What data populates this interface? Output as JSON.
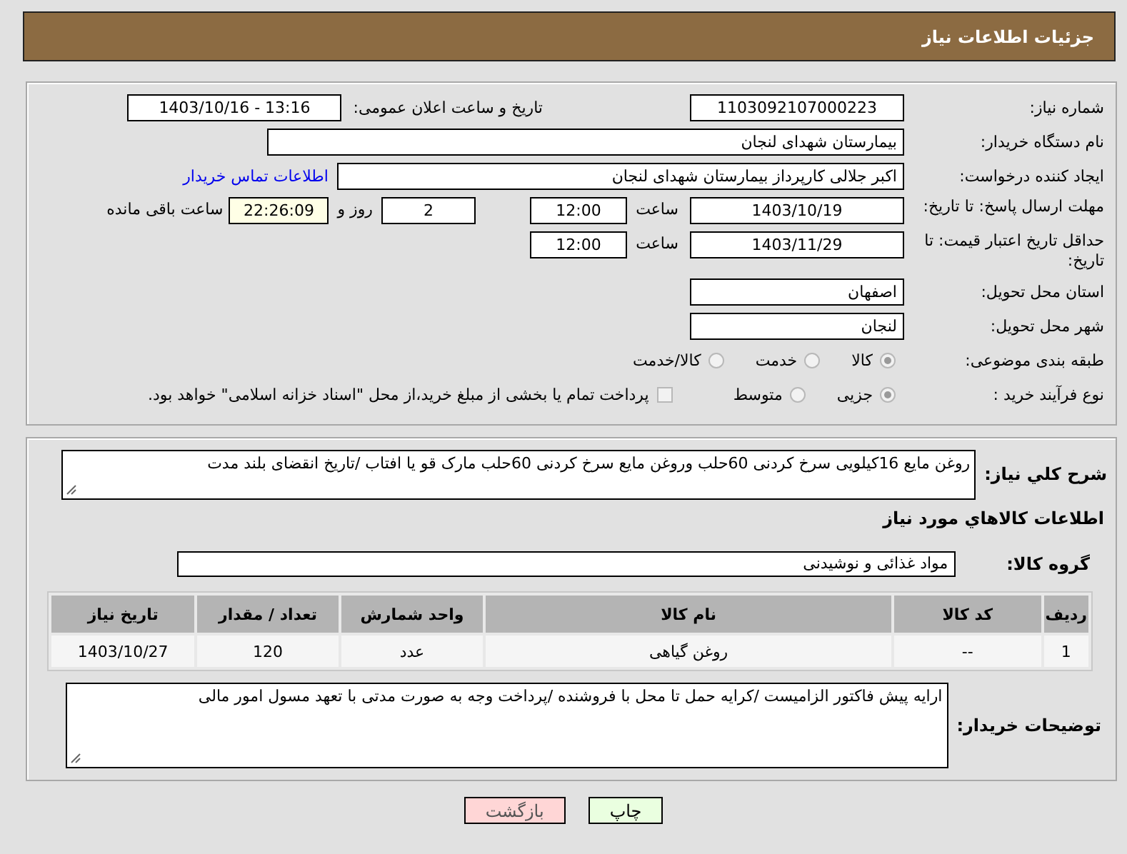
{
  "header": {
    "title": "جزئیات اطلاعات نیاز"
  },
  "details": {
    "need_number": {
      "label": "شماره نیاز:",
      "value": "1103092107000223"
    },
    "announce": {
      "label": "تاریخ و ساعت اعلان عمومی:",
      "value": "1403/10/16 - 13:16"
    },
    "buyer_org": {
      "label": "نام دستگاه خریدار:",
      "value": "بیمارستان شهدای لنجان"
    },
    "requester": {
      "label": "ایجاد کننده درخواست:",
      "value": "اکبر جلالی کارپرداز بیمارستان شهدای لنجان",
      "link": "اطلاعات تماس خریدار"
    },
    "reply_deadline": {
      "label": "مهلت ارسال پاسخ: تا تاریخ:",
      "date": "1403/10/19",
      "time_label": "ساعت",
      "time": "12:00",
      "days": "2",
      "days_label": "روز و",
      "remaining": "22:26:09",
      "remaining_label": "ساعت باقی مانده"
    },
    "price_validity": {
      "label": "حداقل تاریخ اعتبار قیمت: تا تاریخ:",
      "date": "1403/11/29",
      "time_label": "ساعت",
      "time": "12:00"
    },
    "province": {
      "label": "استان محل تحویل:",
      "value": "اصفهان"
    },
    "city": {
      "label": "شهر محل تحویل:",
      "value": "لنجان"
    },
    "category": {
      "label": "طبقه بندی موضوعی:",
      "options": [
        {
          "label": "کالا",
          "selected": true
        },
        {
          "label": "خدمت",
          "selected": false
        },
        {
          "label": "کالا/خدمت",
          "selected": false
        }
      ]
    },
    "process": {
      "label": "نوع فرآیند خرید :",
      "options": [
        {
          "label": "جزیی",
          "selected": true
        },
        {
          "label": "متوسط",
          "selected": false
        }
      ],
      "treasury": {
        "label": "پرداخت تمام یا بخشی از مبلغ خرید،از محل \"اسناد خزانه اسلامی\" خواهد بود.",
        "checked": false
      }
    }
  },
  "description": {
    "label": "شرح کلي نیاز:",
    "value": "روغن مایع 16کیلویی سرخ کردنی 60حلب وروغن مایع سرخ کردنی 60حلب مارک قو یا افتاب /تاریخ انقضای بلند مدت"
  },
  "goods": {
    "title": "اطلاعات کالاهاي مورد نیاز",
    "group_label": "گروه کالا:",
    "group": "مواد غذائی و نوشیدنی",
    "table": {
      "columns": [
        "ردیف",
        "کد کالا",
        "نام کالا",
        "واحد شمارش",
        "تعداد / مقدار",
        "تاریخ نیاز"
      ],
      "rows": [
        [
          "1",
          "--",
          "روغن گیاهی",
          "عدد",
          "120",
          "1403/10/27"
        ]
      ]
    }
  },
  "buyer_notes": {
    "label": "توضیحات خریدار:",
    "value": "ارایه پیش فاکتور الزامیست /کرایه حمل تا محل با فروشنده /پرداخت وجه به صورت مدتی با تعهد مسول امور مالی"
  },
  "buttons": [
    {
      "label": "چاپ",
      "kind": "print"
    },
    {
      "label": "بازگشت",
      "kind": "back"
    }
  ]
}
